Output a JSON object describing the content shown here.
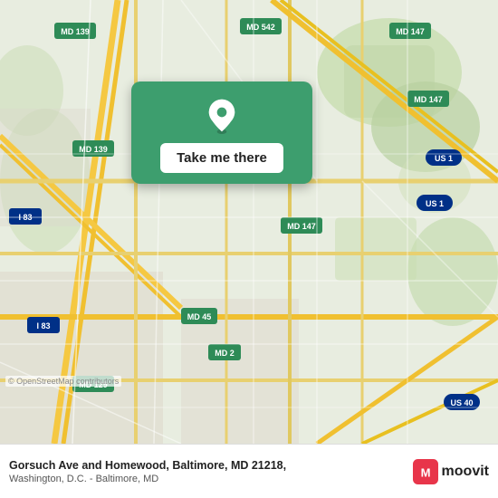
{
  "map": {
    "bg_color": "#e8e0d8",
    "card": {
      "bg_color": "#3d9e6e",
      "button_label": "Take me there",
      "pin_color": "white"
    },
    "osm_credit": "© OpenStreetMap contributors"
  },
  "bottom_bar": {
    "location_line1": "Gorsuch Ave and Homewood, Baltimore, MD 21218,",
    "location_line2": "Washington, D.C. - Baltimore, MD",
    "logo_text": "moovit"
  }
}
